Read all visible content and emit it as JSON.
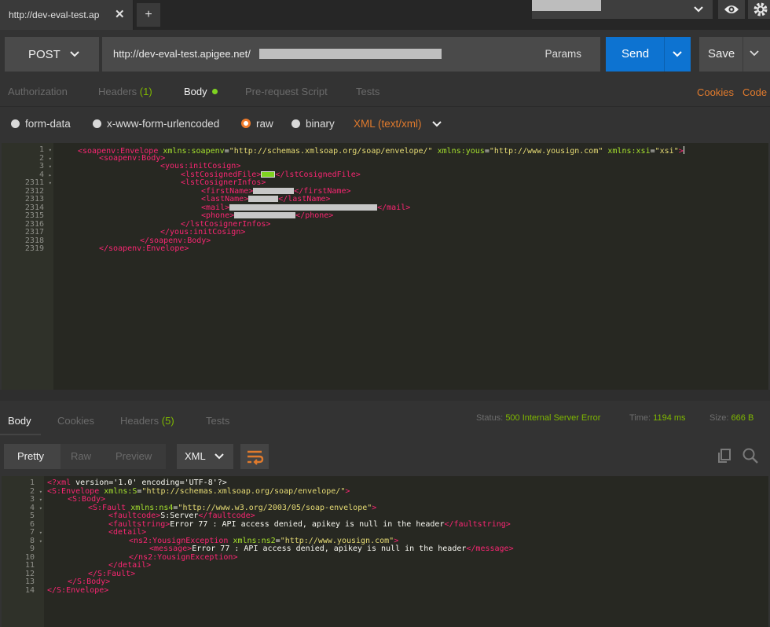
{
  "tab": {
    "title": "http://dev-eval-test.ap",
    "close": "✕",
    "new": "+"
  },
  "request": {
    "method": "POST",
    "url": "http://dev-eval-test.apigee.net/",
    "params_label": "Params",
    "send_label": "Send",
    "save_label": "Save"
  },
  "request_tabs": {
    "authorization": "Authorization",
    "headers": "Headers",
    "headers_count": "(1)",
    "body": "Body",
    "prerequest": "Pre-request Script",
    "tests": "Tests",
    "cookies": "Cookies",
    "code": "Code"
  },
  "body_modes": {
    "form_data": "form-data",
    "urlencoded": "x-www-form-urlencoded",
    "raw": "raw",
    "binary": "binary",
    "content_type": "XML (text/xml)"
  },
  "request_editor": {
    "line_numbers": [
      "1",
      "2",
      "3",
      "4",
      "2311",
      "2312",
      "2313",
      "2314",
      "2315",
      "2316",
      "2317",
      "2318",
      "2319"
    ],
    "fold": [
      "▾",
      "▾",
      "▾",
      "▸",
      "▾",
      "",
      "",
      "",
      "",
      "",
      "",
      "",
      ""
    ],
    "l1_open": "<soapenv:Envelope",
    "l1_attr1": "xmlns:soapenv",
    "l1_val1": "\"http://schemas.xmlsoap.org/soap/envelope/\"",
    "l1_attr2": "xmlns:yous",
    "l1_val2": "\"http://www.yousign.com\"",
    "l1_attr3": "xmlns:xsi",
    "l1_val3": "\"xsi\"",
    "l1_close": ">",
    "l2": "<soapenv:Body>",
    "l3": "<yous:initCosign>",
    "l4_open": "<lstCosignedFile>",
    "l4_close": "</lstCosignedFile>",
    "l5": "<lstCosignerInfos>",
    "l6_open": "<firstName>",
    "l6_close": "</firstName>",
    "l7_open": "<lastName>",
    "l7_close": "</lastName>",
    "l8_open": "<mail>",
    "l8_close": "</mail>",
    "l9_open": "<phone>",
    "l9_close": "</phone>",
    "l10": "</lstCosignerInfos>",
    "l11": "</yous:initCosign>",
    "l12": "</soapenv:Body>",
    "l13": "</soapenv:Envelope>"
  },
  "response_tabs": {
    "body": "Body",
    "cookies": "Cookies",
    "headers": "Headers",
    "headers_count": "(5)",
    "tests": "Tests",
    "status_label": "Status:",
    "status_value": "500 Internal Server Error",
    "time_label": "Time:",
    "time_value": "1194 ms",
    "size_label": "Size:",
    "size_value": "666 B"
  },
  "response_toolbar": {
    "pretty": "Pretty",
    "raw": "Raw",
    "preview": "Preview",
    "format": "XML"
  },
  "response_editor": {
    "line_numbers": [
      "1",
      "2",
      "3",
      "4",
      "5",
      "6",
      "7",
      "8",
      "9",
      "10",
      "11",
      "12",
      "13",
      "14"
    ],
    "fold": [
      "",
      "▾",
      "▾",
      "▾",
      "",
      "",
      "▾",
      "▾",
      "",
      "",
      "",
      "",
      "",
      ""
    ],
    "r1_a": "<?",
    "r1_b": "xml",
    "r1_c": " version='1.0' encoding='UTF-8'?>",
    "r2_open": "<S:Envelope",
    "r2_attr": "xmlns:S",
    "r2_val": "\"http://schemas.xmlsoap.org/soap/envelope/\"",
    "r2_close": ">",
    "r3": "<S:Body>",
    "r4_open": "<S:Fault",
    "r4_attr": "xmlns:ns4",
    "r4_val": "\"http://www.w3.org/2003/05/soap-envelope\"",
    "r4_close": ">",
    "r5_open": "<faultcode>",
    "r5_text": "S:Server",
    "r5_close": "</faultcode>",
    "r6_open": "<faultstring>",
    "r6_text": "Error 77 : API access denied, apikey is null in the header",
    "r6_close": "</faultstring>",
    "r7": "<detail>",
    "r8_open": "<ns2:YousignException",
    "r8_attr": "xmlns:ns2",
    "r8_val": "\"http://www.yousign.com\"",
    "r8_close": ">",
    "r9_open": "<message>",
    "r9_text": "Error 77 : API access denied, apikey is null in the header",
    "r9_close": "</message>",
    "r10": "</ns2:YousignException>",
    "r11": "</detail>",
    "r12": "</S:Fault>",
    "r13": "</S:Body>",
    "r14": "</S:Envelope>"
  },
  "icons": {
    "chevron": "chevron-down-icon",
    "eye": "eye-icon",
    "gear": "gear-icon",
    "wrap": "wrap-lines-icon",
    "copy": "copy-icon",
    "search": "search-icon"
  },
  "colors": {
    "send": "#0d73d1",
    "accent": "#e07a2d",
    "success": "#7fb800",
    "editor_bg": "#272822",
    "xml_tag": "#f92672",
    "xml_attr": "#a6e22e",
    "xml_string": "#e6db74"
  }
}
